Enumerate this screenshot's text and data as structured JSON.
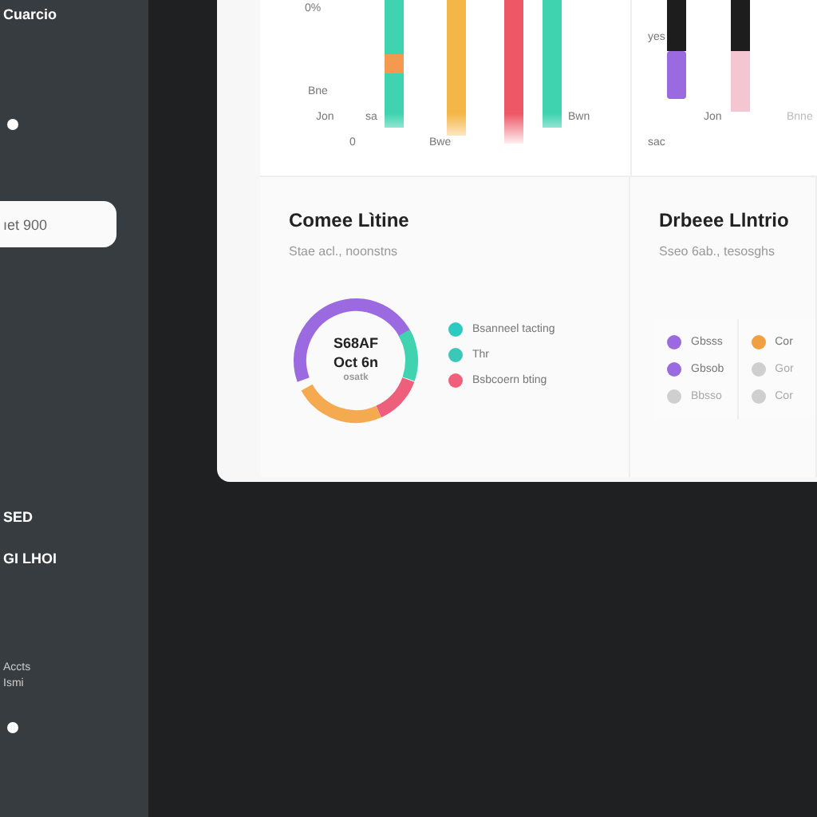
{
  "sidebar": {
    "title": "Cuarcio",
    "field": {
      "value": "ıet 900"
    },
    "items": [
      "SED",
      "GI LHOI"
    ],
    "footer": [
      "Accts",
      "Ismi"
    ]
  },
  "top_charts": [
    {
      "labels": [
        "0%",
        "Bne",
        "Jon",
        "sa",
        "0",
        "Bwe",
        "Bwn"
      ]
    },
    {
      "labels": [
        "yes",
        "Jon",
        "Bnne",
        "sac"
      ]
    }
  ],
  "cards": [
    {
      "title": "Comee Lìtine",
      "subtitle": "Stae acl., noonstns",
      "center": [
        "S68AF",
        "Oct 6n",
        "osatk"
      ],
      "legend": [
        {
          "label": "Bsanneel tacting",
          "color": "#2ec9c0"
        },
        {
          "label": "Thr",
          "color": "#3cc8b8"
        },
        {
          "label": "Bsbcoern bting",
          "color": "#f0607a"
        }
      ]
    },
    {
      "title": "Drbeee Llntrio",
      "subtitle": "Sseo 6ab., tesosghs",
      "columns": [
        [
          {
            "label": "Gbsss",
            "color": "#9b6ae0",
            "disabled": false
          },
          {
            "label": "Gbsob",
            "color": "#9b6ae0",
            "disabled": false
          },
          {
            "label": "Bbsso",
            "color": "#cfcfcf",
            "disabled": true
          }
        ],
        [
          {
            "label": "Cor",
            "color": "#f0a040",
            "disabled": false
          },
          {
            "label": "Gor",
            "color": "#cfcfcf",
            "disabled": true
          },
          {
            "label": "Cor",
            "color": "#cfcfcf",
            "disabled": true
          }
        ]
      ]
    }
  ]
}
